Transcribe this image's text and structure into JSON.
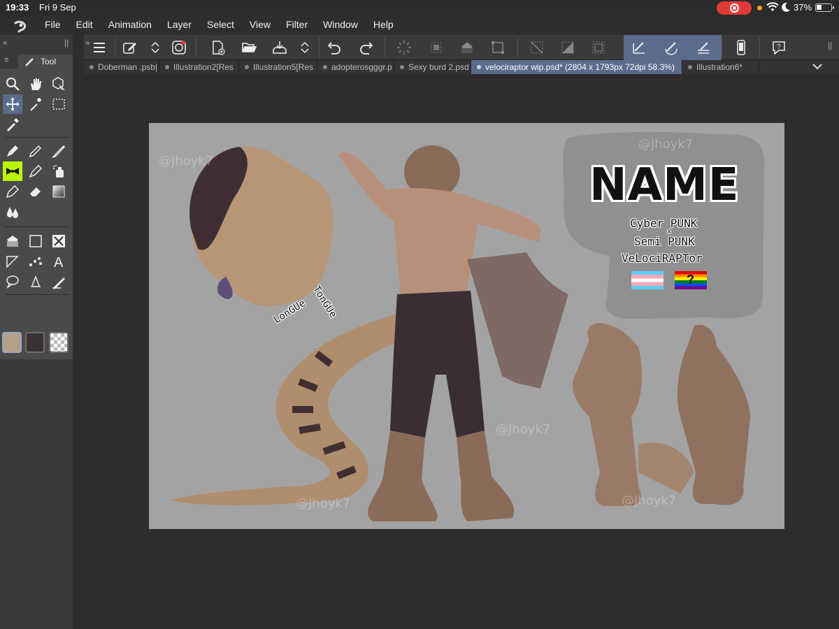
{
  "status_bar": {
    "time": "19:33",
    "date": "Fri 9 Sep",
    "battery": "37%"
  },
  "menu": {
    "items": [
      "File",
      "Edit",
      "Animation",
      "Layer",
      "Select",
      "View",
      "Filter",
      "Window",
      "Help"
    ]
  },
  "tool_panel": {
    "tab_label": "Tool"
  },
  "tabs": [
    {
      "title": "Doberman .psb|",
      "active": false
    },
    {
      "title": "Illustration2[Res",
      "active": false
    },
    {
      "title": "Illustration5[Res",
      "active": false
    },
    {
      "title": "adopterosgggr.p",
      "active": false
    },
    {
      "title": "Sexy burd 2.psd",
      "active": false
    },
    {
      "title": "velociraptor wip.psd* (2804 x 1793px 72dpi 58.3%)",
      "active": true
    },
    {
      "title": "Illustration6*",
      "active": false
    }
  ],
  "artwork": {
    "name_heading": "NAME",
    "desc_line1": "Cyber PUNK",
    "desc_x": "x",
    "desc_line2": "Semi PUNK",
    "desc_line3": "VeLociRAPTor",
    "tongue_label_1": "LonGUe",
    "tongue_label_2": "TonGUe",
    "flag_question": "?",
    "watermark": "@Jhoyk7"
  },
  "colors": {
    "main_color": "#b49f87",
    "sub_color": "#3b3036",
    "accent": "#5b6b8c"
  }
}
